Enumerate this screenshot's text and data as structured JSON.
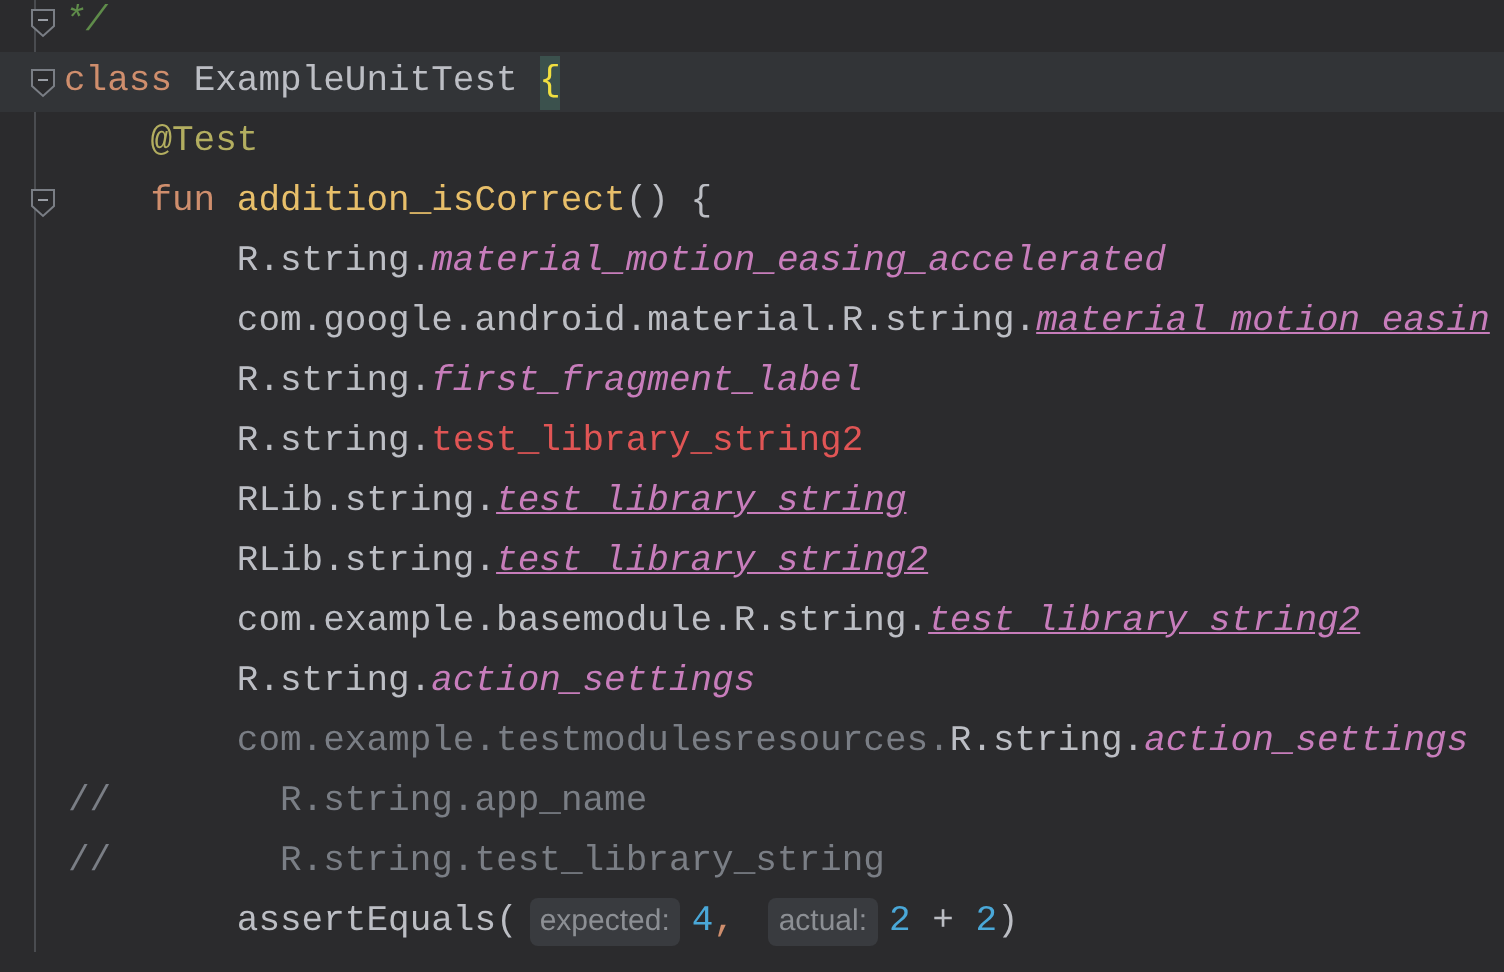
{
  "editor": {
    "lines": [
      {
        "foldable": true,
        "current": false,
        "tokens": [
          {
            "kind": "comment_doc",
            "text": "*/"
          }
        ]
      },
      {
        "foldable": true,
        "current": true,
        "tokens": [
          {
            "kind": "keyword",
            "text": "class"
          },
          {
            "kind": "type",
            "text": "ExampleUnitTest"
          },
          {
            "kind": "brace_matched",
            "text": "{"
          }
        ],
        "children": [
          {
            "foldable": false,
            "current": false,
            "tokens": [
              {
                "kind": "annotation",
                "text": "@Test"
              }
            ]
          },
          {
            "foldable": true,
            "current": false,
            "tokens": [
              {
                "kind": "keyword",
                "text": "fun"
              },
              {
                "kind": "fn_decl",
                "text": "addition_isCorrect"
              },
              {
                "kind": "plain",
                "text": "() {"
              }
            ],
            "children": [
              {
                "foldable": false,
                "current": false,
                "tokens": [
                  {
                    "kind": "plain",
                    "text": "R.string."
                  },
                  {
                    "kind": "res",
                    "text": "material_motion_easing_accelerated"
                  }
                ]
              },
              {
                "foldable": false,
                "current": false,
                "tokens": [
                  {
                    "kind": "plain",
                    "text": "com.google.android.material.R.string."
                  },
                  {
                    "kind": "res_link",
                    "text": "material_motion_easin"
                  }
                ]
              },
              {
                "foldable": false,
                "current": false,
                "tokens": [
                  {
                    "kind": "plain",
                    "text": "R.string."
                  },
                  {
                    "kind": "res",
                    "text": "first_fragment_label"
                  }
                ]
              },
              {
                "foldable": false,
                "current": false,
                "tokens": [
                  {
                    "kind": "plain",
                    "text": "R.string."
                  },
                  {
                    "kind": "unresolved",
                    "text": "test_library_string2"
                  }
                ]
              },
              {
                "foldable": false,
                "current": false,
                "tokens": [
                  {
                    "kind": "plain",
                    "text": "RLib.string."
                  },
                  {
                    "kind": "res_link",
                    "text": "test_library_string"
                  }
                ]
              },
              {
                "foldable": false,
                "current": false,
                "tokens": [
                  {
                    "kind": "plain",
                    "text": "RLib.string."
                  },
                  {
                    "kind": "res_link",
                    "text": "test_library_string2"
                  }
                ]
              },
              {
                "foldable": false,
                "current": false,
                "tokens": [
                  {
                    "kind": "plain",
                    "text": "com.example.basemodule.R.string."
                  },
                  {
                    "kind": "res_link",
                    "text": "test_library_string2"
                  }
                ]
              },
              {
                "foldable": false,
                "current": false,
                "tokens": [
                  {
                    "kind": "plain",
                    "text": "R.string."
                  },
                  {
                    "kind": "res",
                    "text": "action_settings"
                  }
                ]
              },
              {
                "foldable": false,
                "current": false,
                "tokens": [
                  {
                    "kind": "dim",
                    "text": "com.example.testmodulesresources."
                  },
                  {
                    "kind": "plain",
                    "text": "R.string."
                  },
                  {
                    "kind": "res",
                    "text": "action_settings"
                  }
                ]
              },
              {
                "foldable": false,
                "current": false,
                "comment_marker": "//",
                "tokens": [
                  {
                    "kind": "comment",
                    "text": "R.string.app_name"
                  }
                ]
              },
              {
                "foldable": false,
                "current": false,
                "comment_marker": "//",
                "tokens": [
                  {
                    "kind": "comment",
                    "text": "R.string.test_library_string"
                  }
                ]
              },
              {
                "foldable": false,
                "current": false,
                "tokens": [
                  {
                    "kind": "plain",
                    "text": "assertEquals("
                  },
                  {
                    "kind": "hint",
                    "text": "expected:"
                  },
                  {
                    "kind": "number",
                    "text": "4"
                  },
                  {
                    "kind": "op",
                    "text": ","
                  },
                  {
                    "kind": "hint",
                    "text": "actual:"
                  },
                  {
                    "kind": "number",
                    "text": "2"
                  },
                  {
                    "kind": "plain",
                    "text": "+"
                  },
                  {
                    "kind": "number",
                    "text": "2"
                  },
                  {
                    "kind": "plain",
                    "text": ")"
                  }
                ]
              }
            ]
          }
        ]
      }
    ]
  }
}
